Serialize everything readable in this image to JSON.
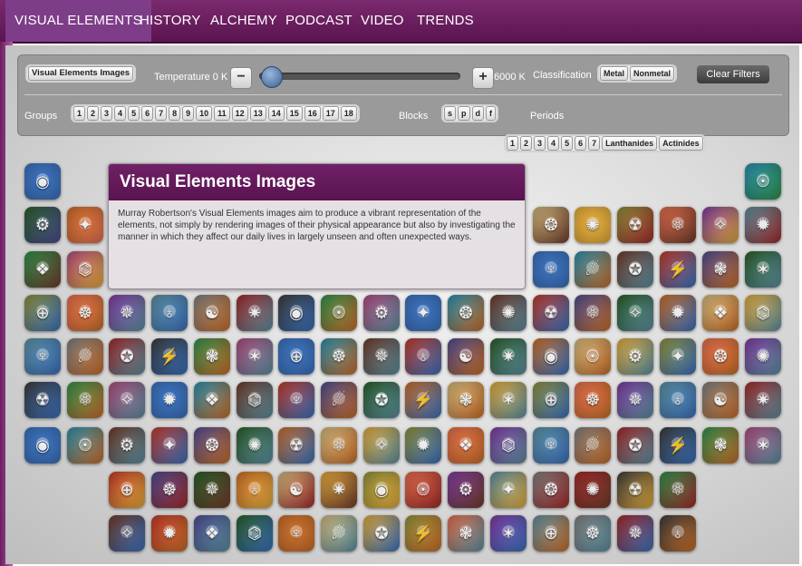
{
  "nav": {
    "tabs": [
      "VISUAL ELEMENTS",
      "HISTORY",
      "ALCHEMY",
      "PODCAST",
      "VIDEO",
      "TRENDS"
    ]
  },
  "controls": {
    "mode_button": "Visual Elements Images",
    "temperature_label": "Temperature 0 K",
    "temperature_value_k": 0,
    "temperature_max": "6000 K",
    "minus": "−",
    "plus": "+",
    "classification_label": "Classification",
    "classification_options": [
      "Metal",
      "Nonmetal"
    ],
    "clear_filters": "Clear Filters",
    "groups_label": "Groups",
    "groups": [
      "1",
      "2",
      "3",
      "4",
      "5",
      "6",
      "7",
      "8",
      "9",
      "10",
      "11",
      "12",
      "13",
      "14",
      "15",
      "16",
      "17",
      "18"
    ],
    "blocks_label": "Blocks",
    "blocks": [
      "s",
      "p",
      "d",
      "f"
    ],
    "periods_label": "Periods",
    "periods": [
      "1",
      "2",
      "3",
      "4",
      "5",
      "6",
      "7",
      "Lanthanides",
      "Actinides"
    ]
  },
  "info": {
    "title": "Visual Elements Images",
    "text": "Murray Robertson's Visual Elements images aim to produce a vibrant representation of the elements, not simply by rendering images of their physical appearance but also by investigating the manner in which they affect our daily lives in largely unseen and often unexpected ways."
  },
  "tile_glyphs": [
    "◉",
    "☉",
    "⚙",
    "✦",
    "❂",
    "✺",
    "☢",
    "⚛",
    "✧",
    "✹",
    "❖",
    "⌬",
    "♆",
    "☄",
    "✪",
    "⚡",
    "❃",
    "✶",
    "⊕",
    "☸",
    "✵",
    "♁",
    "☯",
    "✷"
  ],
  "tile_colors": [
    "#3a6db5",
    "#7a7a7a",
    "#d9a43a",
    "#b83a2a",
    "#2f8a4a",
    "#7b3a9a",
    "#c06a2a",
    "#2a8aa8",
    "#9a2a2a",
    "#8a8a3a",
    "#4a4a8a",
    "#a84a7a",
    "#5a8a9a",
    "#c9b37a",
    "#6a3a2a",
    "#3a3a3a",
    "#d96a4a",
    "#2a5a2a"
  ]
}
